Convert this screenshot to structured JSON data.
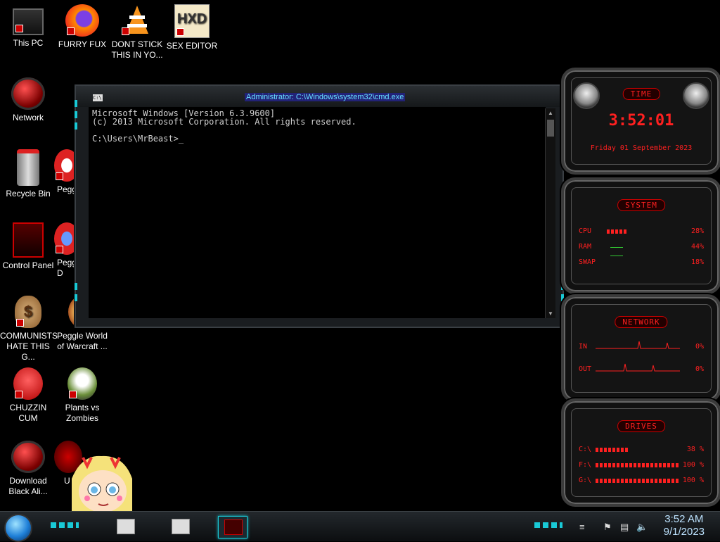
{
  "desktop": {
    "icons": [
      {
        "label": "This PC",
        "icon": "computer-icon"
      },
      {
        "label": "FURRY FUX",
        "icon": "firefox-icon"
      },
      {
        "label": "DONT STICK THIS IN YO...",
        "icon": "vlc-cone-icon"
      },
      {
        "label": "SEX EDITOR",
        "icon": "hxd-editor-icon"
      },
      {
        "label": "Network",
        "icon": "network-icon"
      },
      {
        "label": "Recycle Bin",
        "icon": "recycle-bin-icon"
      },
      {
        "label": "Peggl",
        "icon": "peggle-icon"
      },
      {
        "label": "Control Panel",
        "icon": "control-panel-icon"
      },
      {
        "label": "Peggl D",
        "icon": "peggle-deluxe-icon"
      },
      {
        "label": "COMMUNISTS HATE THIS G...",
        "icon": "money-bag-icon"
      },
      {
        "label": "Peggle World of Warcraft ...",
        "icon": "peggle-wow-icon"
      },
      {
        "label": "CHUZZIN CUM",
        "icon": "chuzzle-icon"
      },
      {
        "label": "Plants vs Zombies",
        "icon": "plants-vs-zombies-icon"
      },
      {
        "label": "Download Black Ali...",
        "icon": "alienware-icon"
      },
      {
        "label": "U",
        "icon": "partial-icon"
      }
    ]
  },
  "cmd": {
    "title": "Administrator: C:\\Windows\\system32\\cmd.exe",
    "sysicon_text": "C:\\.",
    "lines": [
      "Microsoft Windows [Version 6.3.9600]",
      "(c) 2013 Microsoft Corporation. All rights reserved.",
      "",
      "C:\\Users\\MrBeast>_"
    ]
  },
  "gadgets": {
    "time": {
      "title": "TIME",
      "clock": "3:52:01",
      "date": "Friday 01 September 2023"
    },
    "system": {
      "title": "SYSTEM",
      "rows": [
        {
          "label": "CPU",
          "value": "28%",
          "level": 0.28
        },
        {
          "label": "RAM",
          "value": "44%",
          "level": 0.44
        },
        {
          "label": "SWAP",
          "value": "18%",
          "level": 0.18
        }
      ]
    },
    "network": {
      "title": "NETWORK",
      "rows": [
        {
          "label": "IN",
          "value": "0%"
        },
        {
          "label": "OUT",
          "value": "0%"
        }
      ]
    },
    "drives": {
      "title": "DRIVES",
      "rows": [
        {
          "label": "C:\\",
          "value": "38 %",
          "level": 0.38
        },
        {
          "label": "F:\\",
          "value": "100 %",
          "level": 1.0
        },
        {
          "label": "G:\\",
          "value": "100 %",
          "level": 1.0
        }
      ]
    }
  },
  "taskbar": {
    "clock_time": "3:52 AM",
    "clock_date": "9/1/2023",
    "pinned": [
      "window-app-icon",
      "window-app-icon",
      "cmd-active-icon"
    ],
    "tray_icons": [
      "flag-icon",
      "network-icon",
      "volume-icon"
    ]
  },
  "colors": {
    "accent": "#19c9d6",
    "gadget_red": "#ff2020"
  }
}
